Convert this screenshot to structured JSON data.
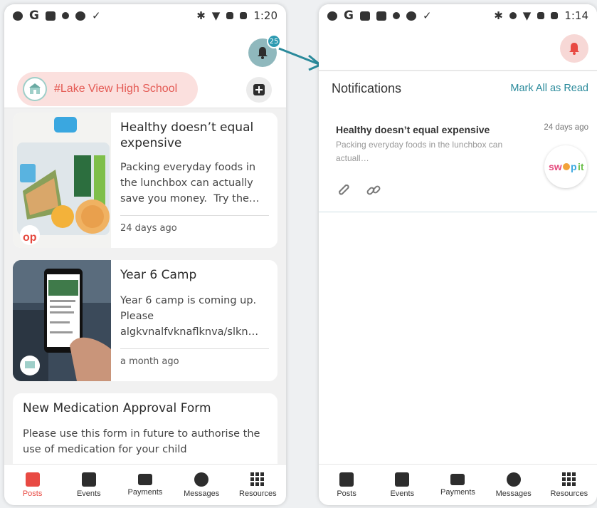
{
  "left_phone": {
    "status_time": "1:20",
    "notification_count": "25",
    "school_name": "#Lake View High School",
    "posts": [
      {
        "title": "Healthy doesn’t equal expensive",
        "text": "Packing everyday foods in the lunchbox can actually save you money.  Try the…",
        "date": "24 days ago"
      },
      {
        "title": "Year 6 Camp",
        "text": "Year 6 camp is coming up.   Please algkvnalfvknaflknva/slkn…",
        "date": "a month ago"
      },
      {
        "title": "New Medication Approval Form",
        "text": "Please use this form in future to authorise the use of medication for your child"
      }
    ]
  },
  "right_phone": {
    "status_time": "1:14",
    "notifications_title": "Notifications",
    "mark_all_label": "Mark All as Read",
    "notification": {
      "title": "Healthy doesn’t equal expensive",
      "text": "Packing everyday foods in the lunchbox can actuall…",
      "date": "24 days ago"
    }
  },
  "bottom_nav": [
    {
      "label": "Posts",
      "icon": "posts-icon"
    },
    {
      "label": "Events",
      "icon": "calendar-icon"
    },
    {
      "label": "Payments",
      "icon": "card-icon"
    },
    {
      "label": "Messages",
      "icon": "chat-icon"
    },
    {
      "label": "Resources",
      "icon": "grid-icon"
    }
  ],
  "colors": {
    "accent_red": "#e84a43",
    "teal": "#2a8a9b",
    "pill_bg": "#fbe0de"
  }
}
